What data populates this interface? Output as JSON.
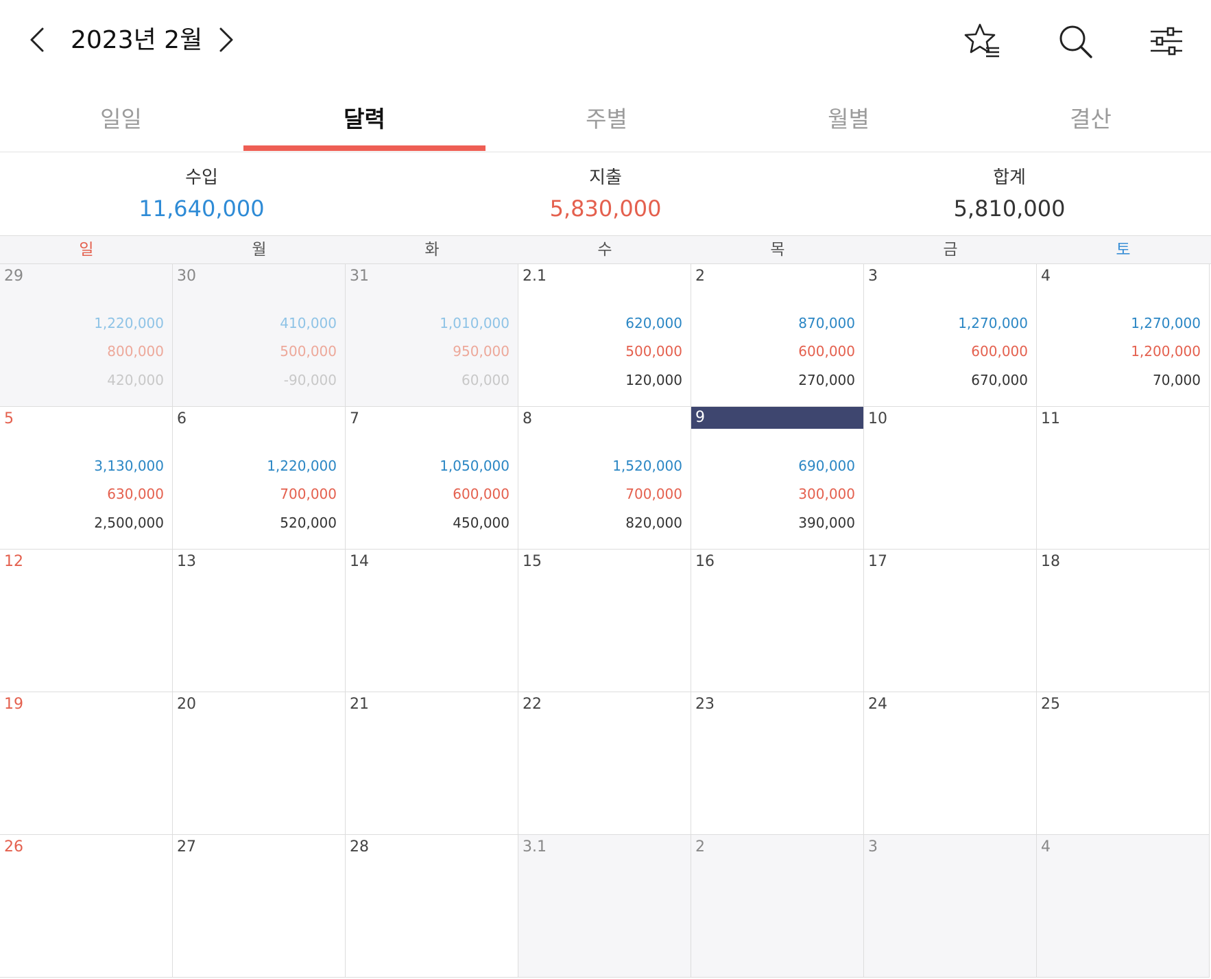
{
  "header": {
    "title": "2023년 2월",
    "prev_icon": "chevron-left-icon",
    "next_icon": "chevron-right-icon",
    "favorite_icon": "star-list-icon",
    "search_icon": "search-icon",
    "filter_icon": "sliders-icon"
  },
  "tabs": [
    {
      "label": "일일",
      "active": false
    },
    {
      "label": "달력",
      "active": true
    },
    {
      "label": "주별",
      "active": false
    },
    {
      "label": "월별",
      "active": false
    },
    {
      "label": "결산",
      "active": false
    }
  ],
  "summary": {
    "income": {
      "label": "수입",
      "value": "11,640,000"
    },
    "expense": {
      "label": "지출",
      "value": "5,830,000"
    },
    "total": {
      "label": "합계",
      "value": "5,810,000"
    }
  },
  "weekdays": [
    "일",
    "월",
    "화",
    "수",
    "목",
    "금",
    "토"
  ],
  "colors": {
    "accent": "#ee5e54",
    "income": "#2e8bd6",
    "income_cell": "#2a86c4",
    "expense": "#e4604e",
    "total": "#333333",
    "sunday": "#e4604e",
    "saturday": "#3a8fd6",
    "today_bg": "#3e466f",
    "income_faded": "#8ec3e6",
    "expense_faded": "#eda89a",
    "total_faded": "#c8c8c8"
  },
  "calendar": {
    "weeks": [
      [
        {
          "day": "29",
          "other": true,
          "income": "1,220,000",
          "expense": "800,000",
          "total": "420,000"
        },
        {
          "day": "30",
          "other": true,
          "income": "410,000",
          "expense": "500,000",
          "total": "-90,000"
        },
        {
          "day": "31",
          "other": true,
          "income": "1,010,000",
          "expense": "950,000",
          "total": "60,000"
        },
        {
          "day": "2.1",
          "income": "620,000",
          "expense": "500,000",
          "total": "120,000"
        },
        {
          "day": "2",
          "income": "870,000",
          "expense": "600,000",
          "total": "270,000"
        },
        {
          "day": "3",
          "income": "1,270,000",
          "expense": "600,000",
          "total": "670,000"
        },
        {
          "day": "4",
          "income": "1,270,000",
          "expense": "1,200,000",
          "total": "70,000"
        }
      ],
      [
        {
          "day": "5",
          "income": "3,130,000",
          "expense": "630,000",
          "total": "2,500,000"
        },
        {
          "day": "6",
          "income": "1,220,000",
          "expense": "700,000",
          "total": "520,000"
        },
        {
          "day": "7",
          "income": "1,050,000",
          "expense": "600,000",
          "total": "450,000"
        },
        {
          "day": "8",
          "income": "1,520,000",
          "expense": "700,000",
          "total": "820,000"
        },
        {
          "day": "9",
          "today": true,
          "income": "690,000",
          "expense": "300,000",
          "total": "390,000"
        },
        {
          "day": "10"
        },
        {
          "day": "11"
        }
      ],
      [
        {
          "day": "12"
        },
        {
          "day": "13"
        },
        {
          "day": "14"
        },
        {
          "day": "15"
        },
        {
          "day": "16"
        },
        {
          "day": "17"
        },
        {
          "day": "18"
        }
      ],
      [
        {
          "day": "19"
        },
        {
          "day": "20"
        },
        {
          "day": "21"
        },
        {
          "day": "22"
        },
        {
          "day": "23"
        },
        {
          "day": "24"
        },
        {
          "day": "25"
        }
      ],
      [
        {
          "day": "26"
        },
        {
          "day": "27"
        },
        {
          "day": "28"
        },
        {
          "day": "3.1",
          "other": true
        },
        {
          "day": "2",
          "other": true
        },
        {
          "day": "3",
          "other": true
        },
        {
          "day": "4",
          "other": true
        }
      ]
    ]
  }
}
